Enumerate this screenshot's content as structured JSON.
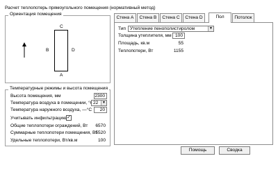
{
  "window_title": "Расчет теплопотерь прямоугольного помещения (нормативный метод)",
  "orientation": {
    "title": "Ориентация помещения",
    "walls": {
      "top": "C",
      "left": "B",
      "right": "D",
      "bottom": "A"
    }
  },
  "temps": {
    "title": "Температурные режимы и высота помещения",
    "height_label": "Высота помещения, мм",
    "height_value": "2300",
    "inside_label": "Температура воздуха в помещении, °С",
    "inside_value": "22",
    "outside_label": "Температура наружного воздуха, —°С",
    "outside_value": "20",
    "infiltration_label": "Учитывать инфильтрацию",
    "infiltration_checked": true,
    "check_glyph": "✓",
    "combo_arrow": "▼",
    "walls_loss_label": "Общие теплопотери ограждений, Вт",
    "walls_loss_value": "6570",
    "total_loss_label": "Суммарные теплопотери помещения, Вт",
    "total_loss_value": "5520",
    "specific_loss_label": "Удельные теплопотери, Вт/кв.м",
    "specific_loss_value": "100"
  },
  "tabs": [
    "Стена A",
    "Стена B",
    "Стена C",
    "Стена D",
    "Пол",
    "Потолок"
  ],
  "active_tab_index": 4,
  "floor": {
    "type_label": "Тип",
    "type_value": "Утепление пенополистиролом",
    "thickness_label": "Толщина утеплителя, мм",
    "thickness_value": "100",
    "area_label": "Площадь, кв.м",
    "area_value": "55",
    "loss_label": "Теплопотери, Вт",
    "loss_value": "1155"
  },
  "buttons": {
    "help": "Помощь",
    "summary": "Сводка"
  }
}
